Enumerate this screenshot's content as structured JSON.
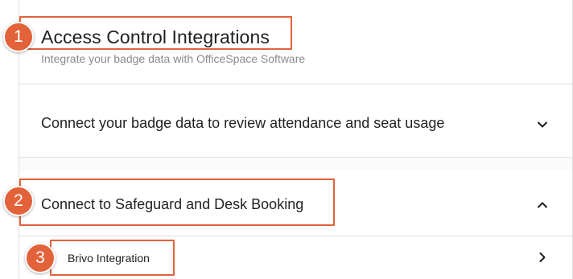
{
  "header": {
    "title": "Access Control Integrations",
    "subtitle": "Integrate your badge data with OfficeSpace Software"
  },
  "sections": [
    {
      "label": "Connect your badge data to review attendance and seat usage",
      "state": "collapsed",
      "icon": "chevron-down-icon"
    },
    {
      "label": "Connect to Safeguard and Desk Booking",
      "state": "expanded",
      "icon": "chevron-up-icon"
    }
  ],
  "subitems": [
    {
      "label": "Brivo Integration",
      "icon": "chevron-right-icon"
    }
  ],
  "annotations": [
    "1",
    "2",
    "3"
  ],
  "colors": {
    "annotation": "#e2623a",
    "border": "#dedede",
    "subtitle": "#8a8a8a"
  }
}
